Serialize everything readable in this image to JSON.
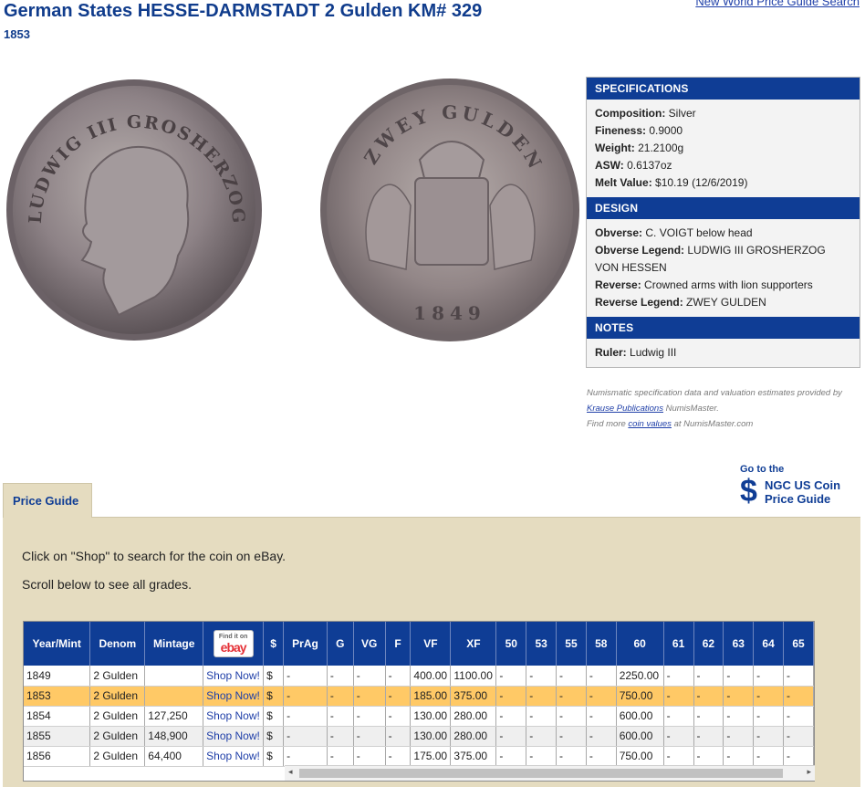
{
  "header": {
    "title": "German States HESSE-DARMSTADT 2 Gulden KM# 329",
    "year": "1853",
    "top_link": "New World Price Guide Search"
  },
  "coin": {
    "obverse_legend_img": "LUDWIG III GROSHERZOG VON HESSEN",
    "reverse_legend_img": "ZWEY GULDEN",
    "reverse_year_img": "1849"
  },
  "specs": {
    "head": "SPECIFICATIONS",
    "rows": [
      {
        "label": "Composition:",
        "value": "Silver"
      },
      {
        "label": "Fineness:",
        "value": "0.9000"
      },
      {
        "label": "Weight:",
        "value": "21.2100g"
      },
      {
        "label": "ASW:",
        "value": "0.6137oz"
      },
      {
        "label": "Melt Value:",
        "value": "$10.19 (12/6/2019)"
      }
    ]
  },
  "design": {
    "head": "DESIGN",
    "rows": [
      {
        "label": "Obverse:",
        "value": "C. VOIGT below head"
      },
      {
        "label": "Obverse Legend:",
        "value": "LUDWIG III GROSHERZOG VON HESSEN"
      },
      {
        "label": "Reverse:",
        "value": "Crowned arms with lion supporters"
      },
      {
        "label": "Reverse Legend:",
        "value": "ZWEY GULDEN"
      }
    ]
  },
  "notes": {
    "head": "NOTES",
    "rows": [
      {
        "label": "Ruler:",
        "value": "Ludwig III"
      }
    ]
  },
  "credit": {
    "line1": "Numismatic specification data and valuation estimates provided by",
    "krause": "Krause Publications",
    "nm": " NumisMaster.",
    "find_more": "Find more ",
    "coin_values": "coin values",
    "at": " at NumisMaster.com"
  },
  "ngc": {
    "goto": "Go to the",
    "dollar": "$",
    "label": "NGC US Coin Price Guide"
  },
  "price_guide": {
    "tab": "Price Guide",
    "info1": "Click on \"Shop\" to search for the coin on eBay.",
    "info2": "Scroll below to see all grades.",
    "ebay_find": "Find it on",
    "ebay_logo": "ebay",
    "columns": [
      "Year/Mint",
      "Denom",
      "Mintage",
      "",
      "$",
      "PrAg",
      "G",
      "VG",
      "F",
      "VF",
      "XF",
      "50",
      "53",
      "55",
      "58",
      "60",
      "61",
      "62",
      "63",
      "64",
      "65"
    ],
    "rows": [
      {
        "cells": [
          "1849",
          "2 Gulden",
          "",
          "Shop Now!",
          "$",
          "-",
          "-",
          "-",
          "-",
          "400.00",
          "1100.00",
          "-",
          "-",
          "-",
          "-",
          "2250.00",
          "-",
          "-",
          "-",
          "-",
          "-"
        ],
        "highlight": false
      },
      {
        "cells": [
          "1853",
          "2 Gulden",
          "",
          "Shop Now!",
          "$",
          "-",
          "-",
          "-",
          "-",
          "185.00",
          "375.00",
          "-",
          "-",
          "-",
          "-",
          "750.00",
          "-",
          "-",
          "-",
          "-",
          "-"
        ],
        "highlight": true
      },
      {
        "cells": [
          "1854",
          "2 Gulden",
          "127,250",
          "Shop Now!",
          "$",
          "-",
          "-",
          "-",
          "-",
          "130.00",
          "280.00",
          "-",
          "-",
          "-",
          "-",
          "600.00",
          "-",
          "-",
          "-",
          "-",
          "-"
        ],
        "highlight": false
      },
      {
        "cells": [
          "1855",
          "2 Gulden",
          "148,900",
          "Shop Now!",
          "$",
          "-",
          "-",
          "-",
          "-",
          "130.00",
          "280.00",
          "-",
          "-",
          "-",
          "-",
          "600.00",
          "-",
          "-",
          "-",
          "-",
          "-"
        ],
        "highlight": false
      },
      {
        "cells": [
          "1856",
          "2 Gulden",
          "64,400",
          "Shop Now!",
          "$",
          "-",
          "-",
          "-",
          "-",
          "175.00",
          "375.00",
          "-",
          "-",
          "-",
          "-",
          "750.00",
          "-",
          "-",
          "-",
          "-",
          "-"
        ],
        "highlight": false
      }
    ]
  },
  "scrollbar": {
    "left_arrow": "◂",
    "right_arrow": "▸"
  }
}
